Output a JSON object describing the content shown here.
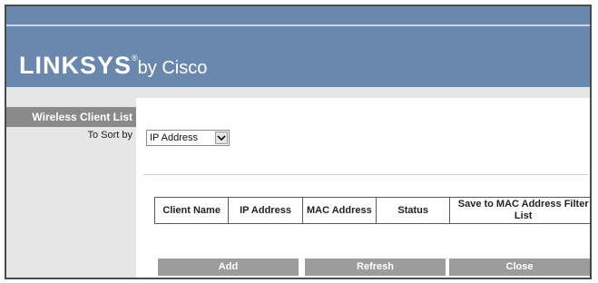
{
  "header": {
    "brand": "LINKSYS",
    "registered": "®",
    "byline": "by Cisco"
  },
  "sidebar": {
    "section_title": "Wireless Client List",
    "sort_label": "To Sort by"
  },
  "sort": {
    "selected": "IP Address",
    "arrow_icon": "chevron-down-icon"
  },
  "table": {
    "headers": [
      "Client Name",
      "IP Address",
      "MAC Address",
      "Status",
      "Save to MAC Address Filter List"
    ]
  },
  "buttons": {
    "add": "Add",
    "refresh": "Refresh",
    "close": "Close"
  },
  "colors": {
    "header_blue": "#6a88ad",
    "sidebar_grey": "#e6e6e6",
    "section_grey": "#8a8a8a",
    "button_grey": "#9c9c9c"
  }
}
